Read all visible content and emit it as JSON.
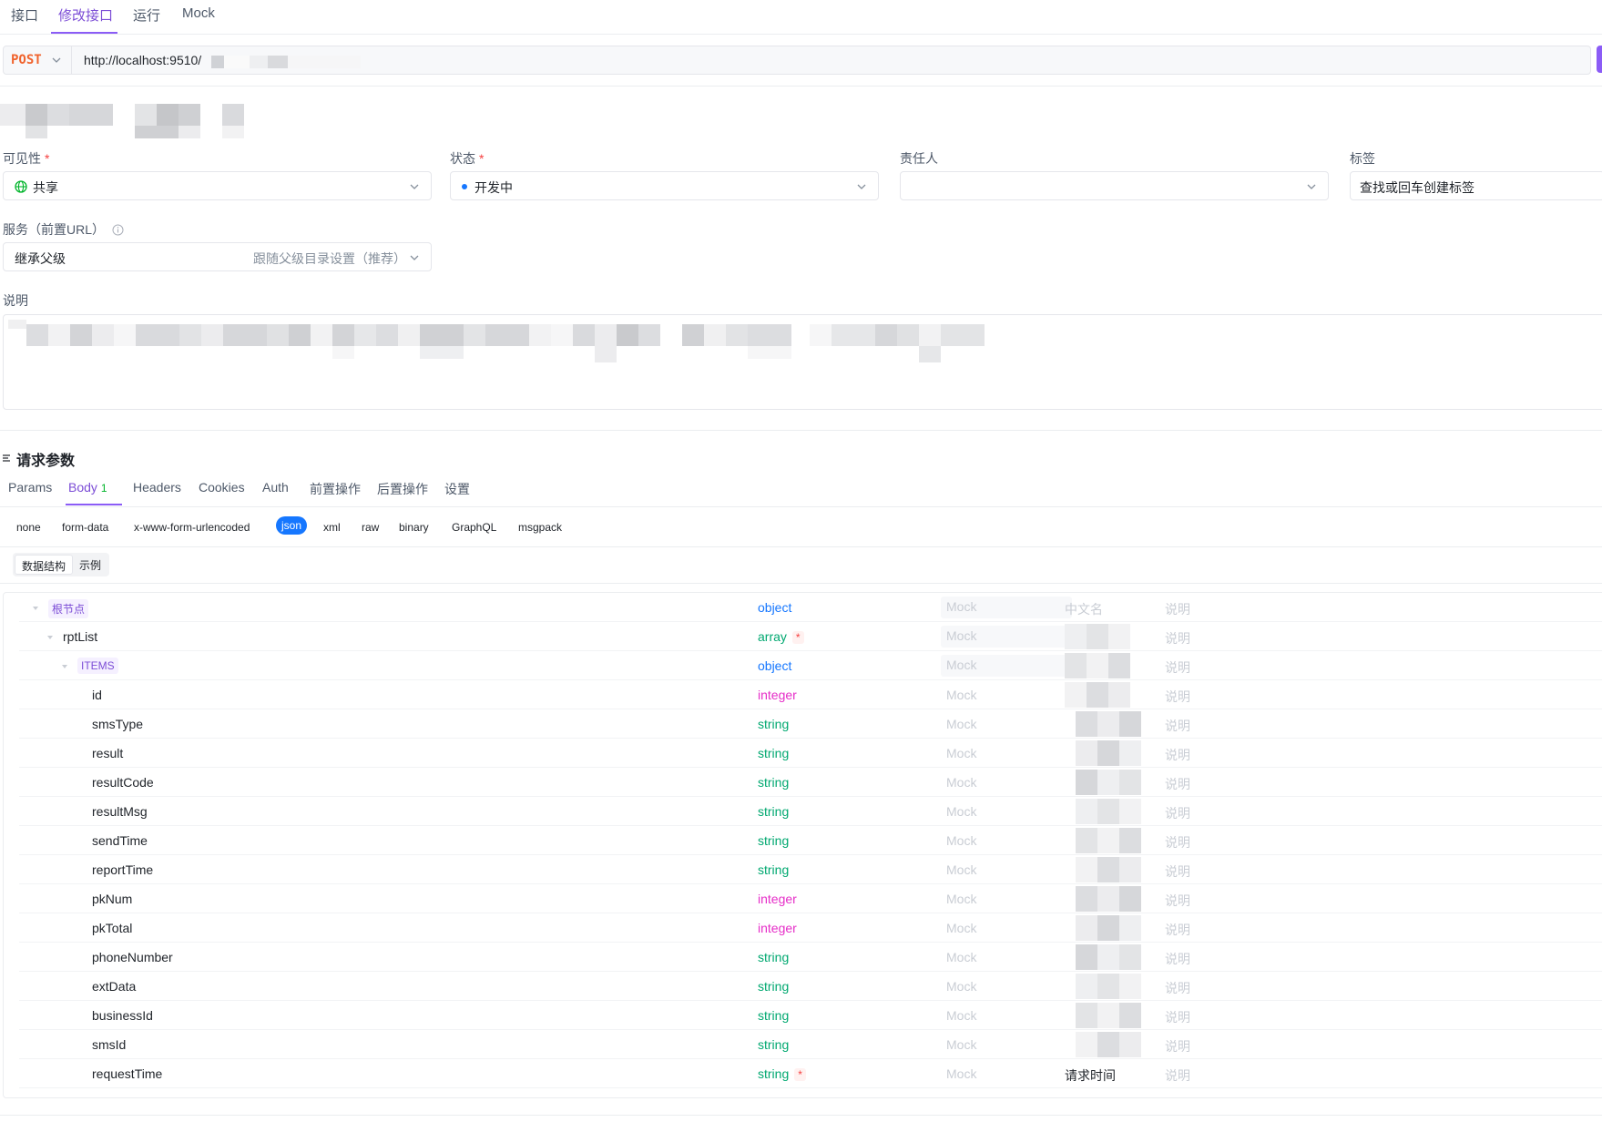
{
  "top_tabs": [
    "接口",
    "修改接口",
    "运行",
    "Mock"
  ],
  "url_bar": {
    "method": "POST",
    "url": "http://localhost:9510/"
  },
  "form": {
    "visibility_label": "可见性",
    "visibility_value": "共享",
    "status_label": "状态",
    "status_value": "开发中",
    "owner_label": "责任人",
    "tags_label": "标签",
    "tags_placeholder": "查找或回车创建标签",
    "service_label": "服务（前置URL）",
    "service_value": "继承父级",
    "service_hint": "跟随父级目录设置（推荐）",
    "description_label": "说明"
  },
  "request_params": {
    "title": "请求参数",
    "tabs": [
      "Params",
      "Body",
      "Headers",
      "Cookies",
      "Auth",
      "前置操作",
      "后置操作",
      "设置"
    ],
    "body_count": "1",
    "body_types": [
      "none",
      "form-data",
      "x-www-form-urlencoded",
      "json",
      "xml",
      "raw",
      "binary",
      "GraphQL",
      "msgpack"
    ],
    "active_body_type": "json",
    "view_modes": [
      "数据结构",
      "示例"
    ]
  },
  "schema": {
    "mock_label": "Mock",
    "cn_placeholder": "中文名",
    "desc_placeholder": "说明",
    "rows": [
      {
        "name": "根节点",
        "type": "object",
        "required": false,
        "cn": ""
      },
      {
        "name": "rptList",
        "type": "array",
        "required": true,
        "cn": ""
      },
      {
        "name": "ITEMS",
        "type": "object",
        "required": false,
        "cn": ""
      },
      {
        "name": "id",
        "type": "integer",
        "required": false,
        "cn": ""
      },
      {
        "name": "smsType",
        "type": "string",
        "required": false,
        "cn": ""
      },
      {
        "name": "result",
        "type": "string",
        "required": false,
        "cn": ""
      },
      {
        "name": "resultCode",
        "type": "string",
        "required": false,
        "cn": ""
      },
      {
        "name": "resultMsg",
        "type": "string",
        "required": false,
        "cn": ""
      },
      {
        "name": "sendTime",
        "type": "string",
        "required": false,
        "cn": ""
      },
      {
        "name": "reportTime",
        "type": "string",
        "required": false,
        "cn": ""
      },
      {
        "name": "pkNum",
        "type": "integer",
        "required": false,
        "cn": ""
      },
      {
        "name": "pkTotal",
        "type": "integer",
        "required": false,
        "cn": ""
      },
      {
        "name": "phoneNumber",
        "type": "string",
        "required": false,
        "cn": ""
      },
      {
        "name": "extData",
        "type": "string",
        "required": false,
        "cn": ""
      },
      {
        "name": "businessId",
        "type": "string",
        "required": false,
        "cn": ""
      },
      {
        "name": "smsId",
        "type": "string",
        "required": false,
        "cn": ""
      },
      {
        "name": "requestTime",
        "type": "string",
        "required": true,
        "cn": "请求时间"
      }
    ]
  },
  "colors": {
    "accent": "#8b5cf6",
    "method_post": "#f0632d",
    "type_object": "#1677ff",
    "type_string": "#00a870",
    "type_integer": "#e62ec8",
    "json_active": "#1677ff"
  }
}
